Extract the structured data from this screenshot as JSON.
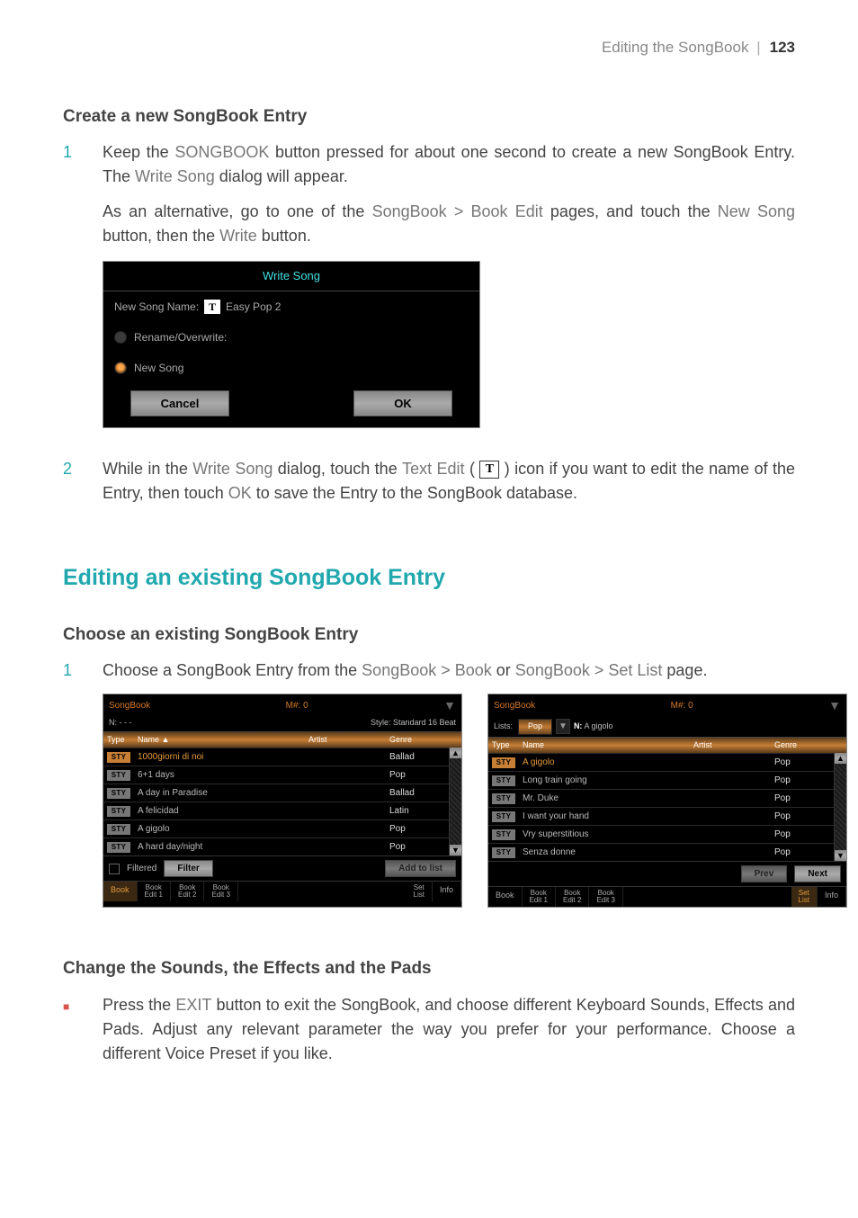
{
  "header": {
    "crumb": "Editing the SongBook",
    "page_label": "123"
  },
  "h_create": "Create a new SongBook Entry",
  "step1a": {
    "num": "1",
    "p1_a": "Keep the ",
    "p1_b": "SONGBOOK",
    "p1_c": " button pressed for about one second to create a new SongBook Entry. The ",
    "p1_d": "Write Song",
    "p1_e": " dialog will appear.",
    "p2_a": "As an alternative, go to one of the ",
    "p2_b": "SongBook > Book Edit",
    "p2_c": " pages, and touch the ",
    "p2_d": "New Song",
    "p2_e": " button, then the ",
    "p2_f": "Write",
    "p2_g": " button."
  },
  "writeSong": {
    "title": "Write Song",
    "name_label": "New Song Name:",
    "name_value": "Easy Pop 2",
    "opt_rename": "Rename/Overwrite:",
    "opt_new": "New Song",
    "cancel": "Cancel",
    "ok": "OK"
  },
  "step2a": {
    "num": "2",
    "a": "While in the ",
    "b": "Write Song",
    "c": " dialog, touch the ",
    "d": "Text Edit",
    "e": " ( ",
    "g": " ) icon if you want to edit the name of the Entry, then touch ",
    "h": "OK",
    "i": " to save the Entry to the SongBook database."
  },
  "section2": "Editing an existing SongBook Entry",
  "h_choose": "Choose an existing SongBook Entry",
  "step1b": {
    "num": "1",
    "a": "Choose a SongBook Entry from the ",
    "b": "SongBook > Book",
    "c": " or ",
    "d": "SongBook > Set List",
    "e": " page."
  },
  "panel1": {
    "title": "SongBook",
    "meas": "M#: 0",
    "sub_left": "N: - - -",
    "sub_right": "Style: Standard 16 Beat",
    "head": {
      "type": "Type",
      "name": "Name",
      "artist": "Artist",
      "genre": "Genre"
    },
    "rows": [
      {
        "name": "1000giorni di noi",
        "genre": "Ballad",
        "sel": true
      },
      {
        "name": "6+1 days",
        "genre": "Pop"
      },
      {
        "name": "A day in Paradise",
        "genre": "Ballad"
      },
      {
        "name": "A felicidad",
        "genre": "Latin"
      },
      {
        "name": "A gigolo",
        "genre": "Pop"
      },
      {
        "name": "A hard day/night",
        "genre": "Pop"
      }
    ],
    "filtered": "Filtered",
    "filter": "Filter",
    "add": "Add to list",
    "tabs": [
      "Book",
      "Book\nEdit 1",
      "Book\nEdit 2",
      "Book\nEdit 3",
      "Set\nList",
      "Info"
    ],
    "tab_sel": 0
  },
  "panel2": {
    "title": "SongBook",
    "meas": "M#: 0",
    "lists_label": "Lists:",
    "list_value": "Pop",
    "n_label": "N:",
    "n_value": "A gigolo",
    "head": {
      "type": "Type",
      "name": "Name",
      "artist": "Artist",
      "genre": "Genre"
    },
    "rows": [
      {
        "name": "A gigolo",
        "genre": "Pop",
        "sel": true
      },
      {
        "name": "Long train going",
        "genre": "Pop"
      },
      {
        "name": "Mr. Duke",
        "genre": "Pop"
      },
      {
        "name": "I want your hand",
        "genre": "Pop"
      },
      {
        "name": "Vry superstitious",
        "genre": "Pop"
      },
      {
        "name": "Senza donne",
        "genre": "Pop"
      }
    ],
    "prev": "Prev",
    "next": "Next",
    "tabs": [
      "Book",
      "Book\nEdit 1",
      "Book\nEdit 2",
      "Book\nEdit 3",
      "Set\nList",
      "Info"
    ],
    "tab_sel": 4
  },
  "h_change": "Change the Sounds, the Effects and the Pads",
  "bullet1": {
    "a": "Press the ",
    "b": "EXIT",
    "c": " button to exit the SongBook, and choose different Keyboard Sounds, Effects and Pads. Adjust any relevant parameter the way you prefer for your performance. Choose a different Voice Preset if you like."
  },
  "glyph": {
    "up": "▲",
    "down": "▼",
    "square": "■",
    "T": "T",
    "bullet": "■"
  }
}
